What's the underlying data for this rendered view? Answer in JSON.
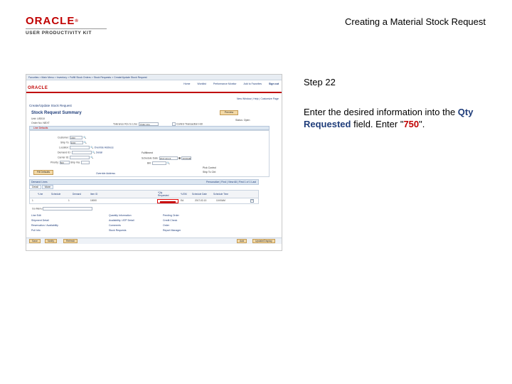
{
  "header": {
    "logo_main": "ORACLE",
    "logo_reg": "®",
    "logo_sub": "USER PRODUCTIVITY KIT",
    "title": "Creating a Material Stock Request"
  },
  "instruction": {
    "step": "Step 22",
    "text_before": "Enter the desired information into the ",
    "field": "Qty Requested",
    "text_middle": " field. Enter \"",
    "value": "750",
    "text_after": "\"."
  },
  "screenshot": {
    "breadcrumb": "Favorites  >  Main Menu  >  Inventory  >  Fulfill Stock Orders  >  Stock Requests  >  Create/Update Stock Request",
    "brand": "ORACLE",
    "topnav": [
      "Home",
      "Worklist",
      "Performance Monitor",
      "Add to Favorites",
      "Sign out"
    ],
    "links": "New Window | Help | Customize Page",
    "page_caption": "Create/Update Stock Request",
    "page_title": "Stock Request Summary",
    "preview_label": "Preview",
    "unit_label": "Unit:",
    "unit_value": "US010",
    "order_label": "Order No:",
    "order_value": "NEXT",
    "processing_label": "Tolerance Rcv to Line:",
    "processing_value": "Order Line",
    "ctrl_label": "Control Transaction Hdr",
    "status_label": "Status:",
    "status_value": "Open",
    "section_label": "Line Defaults",
    "customer_label": "Customer:",
    "customer_value": "1000",
    "shipto_label": "Ship To:",
    "shipto_value": "1000",
    "location_label": "Location:",
    "override_link": "Override Address",
    "demand_label": "Demand ID:",
    "detail_link": "Detail",
    "carrier_label": "Carrier ID:",
    "ship_via_label": "Ship Via:",
    "priority_label": "Priority:",
    "priority_value": "500",
    "fulfill_label": "Fulfillment",
    "schedule_label": "Schedule Date:",
    "schedule_value": "2017-02-13",
    "schedule_time": "10:00AM",
    "bill_label": "Bill:",
    "pick_label": "Pick Control",
    "ship_label": "Ship To Ctrl:",
    "fill_btn": "Fill Defaults",
    "grid_title": "Demand Lines",
    "grid_nav": "Personalize | Find | View All | First  1 of 1  Last",
    "tab_detail": "Detail",
    "tab_more": "More",
    "col_line": "*Line",
    "col_schedule": "Schedule",
    "col_demand": "Demand",
    "col_item": "Item ID",
    "col_qty": "*Qty Requested",
    "col_uom": "*UOM",
    "col_sched_date": "Schedule Date",
    "col_sched_time": "Schedule Time",
    "row_line": "1",
    "row_schedule": "1",
    "row_item": "10000",
    "row_uom": "EA",
    "row_date": "2017-02-13",
    "row_time": "10:00AM",
    "go_label": "Go Menu",
    "links_col1": [
      "Line Edit",
      "Shipment Detail",
      "Reservation / Availability",
      "Pull Info"
    ],
    "links_col2": [
      "Quantity Information",
      "Availability / ATP Detail",
      "Comments",
      "Stock Requests"
    ],
    "links_col3": [
      "Pending Order",
      "Credit Check",
      "Order",
      "Report Manager"
    ],
    "btn_save": "Save",
    "btn_notify": "Notify",
    "btn_refresh": "Refresh",
    "btn_add": "Add",
    "btn_update": "Update/Display"
  }
}
